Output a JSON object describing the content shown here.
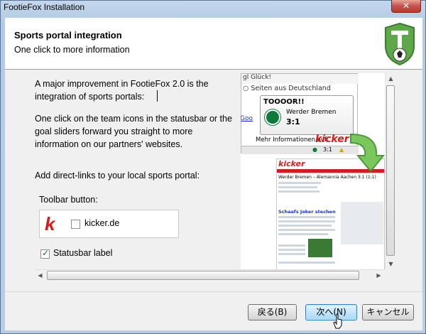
{
  "window": {
    "title": "FootieFox Installation",
    "close_label": "✕"
  },
  "header": {
    "title": "Sports portal integration",
    "subtitle": "One click to more information"
  },
  "content": {
    "paragraph1": "A major improvement in FootieFox 2.0 is the integration of sports portals:",
    "paragraph2": "One click on the team icons in the statusbar or the goal sliders forward you straight to more information on our partners' websites.",
    "paragraph3": "Add direct-links to your local sports portal:",
    "toolbar_label": "Toolbar button:",
    "kicker_logo": "k",
    "kicker_option": "kicker.de",
    "kicker_checked": false,
    "statusbar_label": "Statusbar label",
    "statusbar_checked": true
  },
  "preview": {
    "top_text": "gl Glück!",
    "radio_text": "Seiten aus Deutschland",
    "left_link": "Goo",
    "goal_text": "TOOOOR!!",
    "team": "Werder Bremen",
    "score": "3:1",
    "more_info": "Mehr Informationen auf",
    "kicker_brand": "kicker",
    "status_score": "3:1",
    "site_logo": "kicker",
    "site_match": "Werder Bremen – Alemannia Aachen 3:1 (1:1)",
    "site_headline": "Schaafs Joker stechen"
  },
  "buttons": {
    "back": "戻る(B)",
    "next": "次へ(N)",
    "cancel": "キャンセル"
  },
  "colors": {
    "accent_red": "#d81a1a",
    "werder_green": "#0c7a3a",
    "default_button": "#a7d9f5"
  }
}
